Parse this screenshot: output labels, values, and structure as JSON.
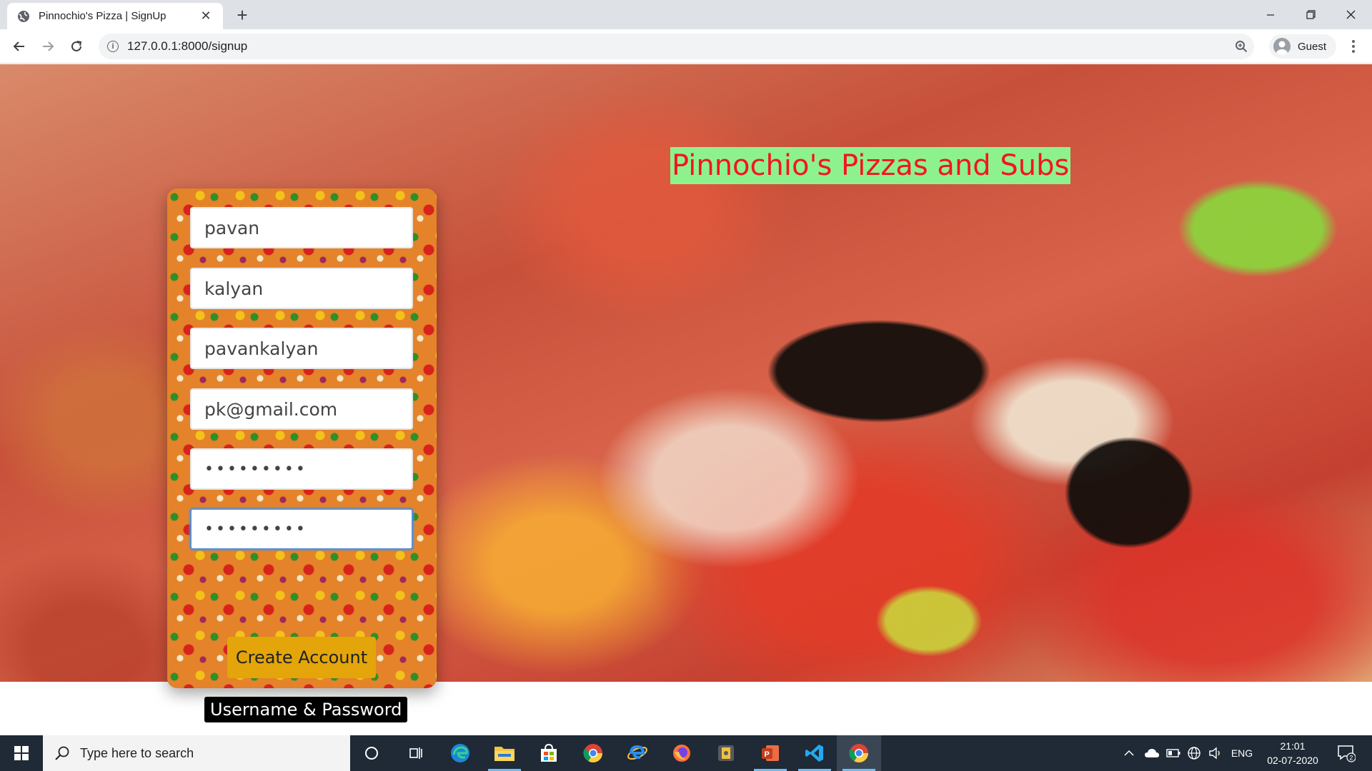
{
  "browser": {
    "tab_title": "Pinnochio's Pizza | SignUp",
    "url": "127.0.0.1:8000/signup",
    "profile_label": "Guest"
  },
  "page": {
    "brand_title": "Pinnochio's Pizzas and Subs",
    "form": {
      "first_name": "pavan",
      "last_name": "kalyan",
      "username": "pavankalyan",
      "email": "pk@gmail.com",
      "password_mask": "•••••••••",
      "confirm_password_mask": "•••••••••",
      "submit_label": "Create Account",
      "footer_label": "Username & Password"
    },
    "colors": {
      "title_text": "#f4141f",
      "title_background": "#8df28d",
      "button_background": "#e3a50a",
      "focus_border": "#5a8fd0"
    }
  },
  "taskbar": {
    "search_placeholder": "Type here to search",
    "language": "ENG",
    "time": "21:01",
    "date": "02-07-2020",
    "notification_count": "2",
    "pinned_apps": [
      "cortana",
      "task-view",
      "edge",
      "file-explorer",
      "store",
      "chrome",
      "internet-explorer",
      "firefox",
      "app",
      "powerpoint",
      "vscode",
      "chrome-active"
    ]
  }
}
